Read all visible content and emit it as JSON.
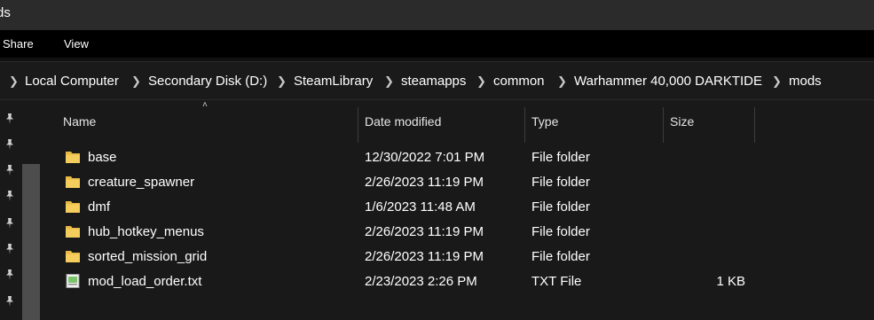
{
  "window": {
    "title": "ds"
  },
  "ribbon": {
    "tabs": [
      "Share",
      "View"
    ]
  },
  "breadcrumb": [
    "Local Computer",
    "Secondary Disk (D:)",
    "SteamLibrary",
    "steamapps",
    "common",
    "Warhammer 40,000 DARKTIDE",
    "mods"
  ],
  "columns": {
    "name": "Name",
    "date": "Date modified",
    "type": "Type",
    "size": "Size"
  },
  "files": [
    {
      "name": "base",
      "date": "12/30/2022 7:01 PM",
      "type": "File folder",
      "size": "",
      "icon": "folder-icon"
    },
    {
      "name": "creature_spawner",
      "date": "2/26/2023 11:19 PM",
      "type": "File folder",
      "size": "",
      "icon": "folder-icon"
    },
    {
      "name": "dmf",
      "date": "1/6/2023 11:48 AM",
      "type": "File folder",
      "size": "",
      "icon": "folder-icon"
    },
    {
      "name": "hub_hotkey_menus",
      "date": "2/26/2023 11:19 PM",
      "type": "File folder",
      "size": "",
      "icon": "folder-icon"
    },
    {
      "name": "sorted_mission_grid",
      "date": "2/26/2023 11:19 PM",
      "type": "File folder",
      "size": "",
      "icon": "folder-icon"
    },
    {
      "name": "mod_load_order.txt",
      "date": "2/23/2023 2:26 PM",
      "type": "TXT File",
      "size": "1 KB",
      "icon": "text-file-icon"
    }
  ],
  "colors": {
    "folder": "#e8b945",
    "background": "#191919",
    "ribbon": "#000000"
  }
}
